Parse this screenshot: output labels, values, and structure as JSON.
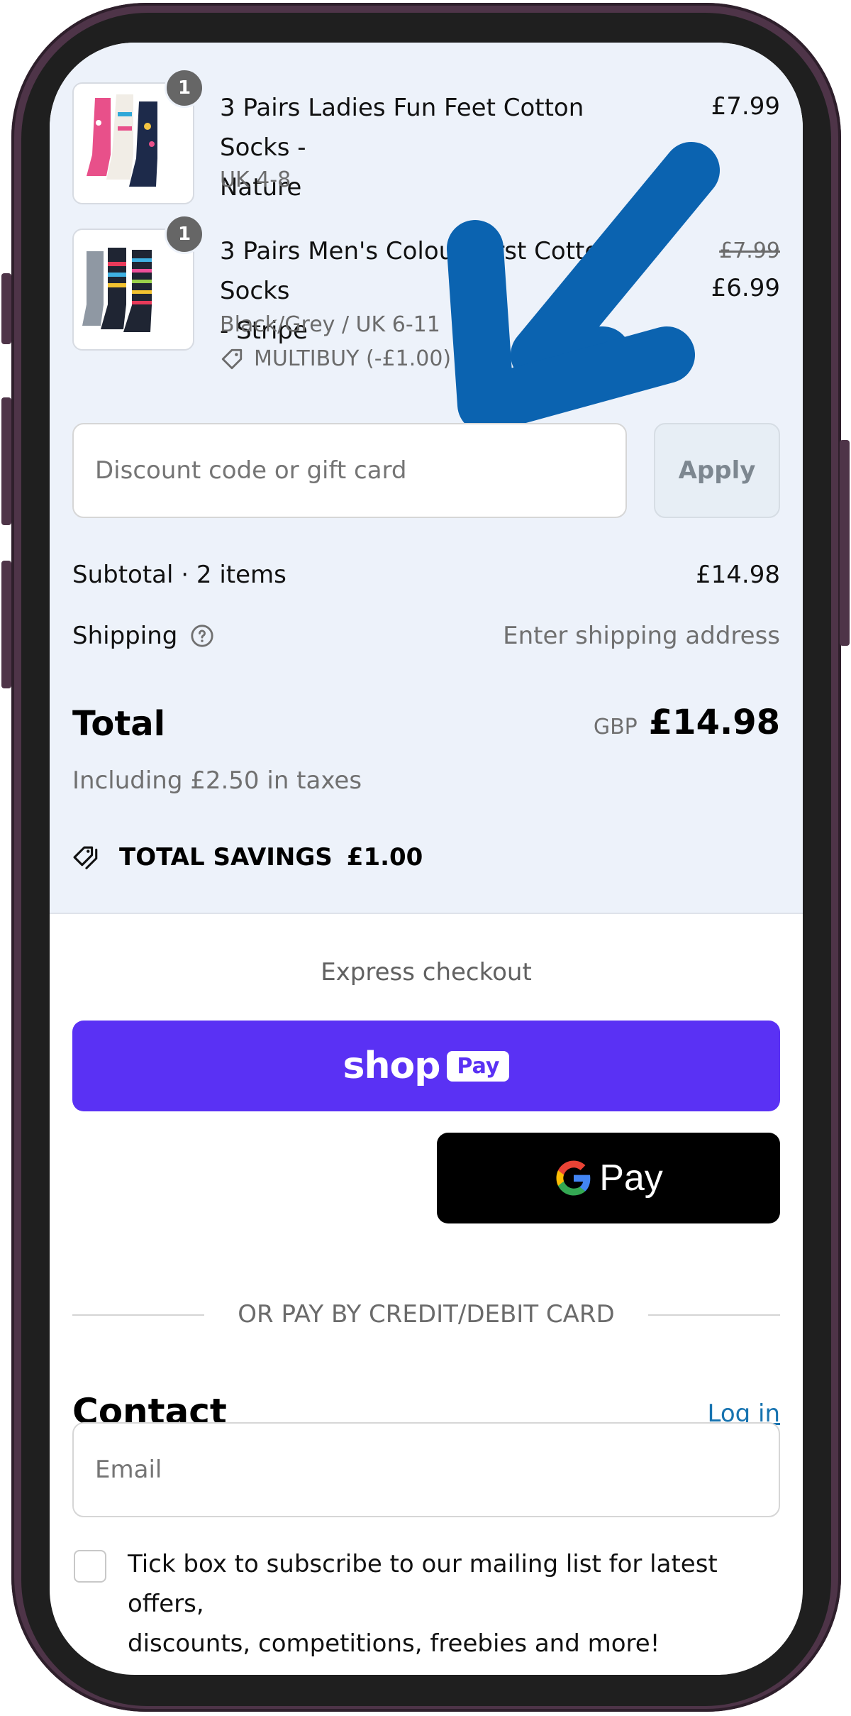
{
  "cart": {
    "items": [
      {
        "quantity": "1",
        "title_line1": "3 Pairs Ladies Fun Feet Cotton Socks -",
        "title_line2": "Nature",
        "variant": "UK 4-8",
        "price": "£7.99"
      },
      {
        "quantity": "1",
        "title_line1": "3 Pairs Men's Colourburst Cotton Socks",
        "title_line2": "- Stripe",
        "variant": "Black/Grey / UK 6-11",
        "discount": "MULTIBUY (-£1.00)",
        "original_price": "£7.99",
        "price": "£6.99"
      }
    ]
  },
  "discount": {
    "placeholder": "Discount code or gift card",
    "apply_label": "Apply"
  },
  "totals": {
    "subtotal_label": "Subtotal · 2 items",
    "subtotal_value": "£14.98",
    "shipping_label": "Shipping",
    "shipping_value": "Enter shipping address",
    "total_label": "Total",
    "currency": "GBP",
    "total_value": "£14.98",
    "tax_note": "Including £2.50 in taxes",
    "savings_label": "TOTAL SAVINGS",
    "savings_value": "£1.00"
  },
  "express": {
    "heading": "Express checkout",
    "shop_label": "shop",
    "shop_pay_badge": "Pay",
    "gpay_label": "Pay"
  },
  "divider_text": "OR PAY BY CREDIT/DEBIT CARD",
  "contact": {
    "heading": "Contact",
    "login_link": "Log in",
    "email_placeholder": "Email",
    "subscribe_line1": "Tick box to subscribe to our mailing list for latest offers,",
    "subscribe_line2": "discounts, competitions, freebies and more!"
  },
  "colors": {
    "summary_bg": "#edf2fa",
    "shop_pay": "#5a31f4",
    "link": "#1773b0",
    "annotation_arrow": "#0b63b0"
  }
}
